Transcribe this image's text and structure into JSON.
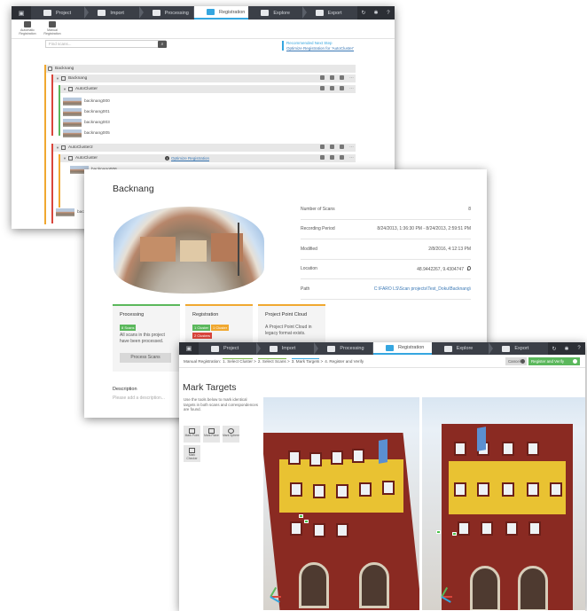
{
  "nav": {
    "tabs": [
      {
        "label": "Project"
      },
      {
        "label": "Import"
      },
      {
        "label": "Processing"
      },
      {
        "label": "Registration"
      },
      {
        "label": "Explore"
      },
      {
        "label": "Export"
      }
    ]
  },
  "win1": {
    "ribbon": [
      {
        "label": "Automatic Registration"
      },
      {
        "label": "Manual Registration"
      }
    ],
    "search_placeholder": "Find scans...",
    "recommended_title": "Recommended Next Step",
    "recommended_link": "Optimize Registration for 'AutoCluster'",
    "tree": {
      "root": "Backnang",
      "node1": "Backnang",
      "cluster1": "AutoCluster",
      "scans1": [
        "backnang000",
        "backnang001",
        "backnang003",
        "backnang005"
      ],
      "cluster2": "AutoCluster2",
      "cluster3": "AutoCluster",
      "optimize": "Optimize Registration",
      "scan6": "backnang006",
      "partial": "back"
    }
  },
  "win2": {
    "title": "Backnang",
    "properties": [
      {
        "key": "Number of Scans",
        "value": "8"
      },
      {
        "key": "Recording Period",
        "value": "8/24/2013, 1:36:30 PM - 8/24/2013, 2:59:51 PM"
      },
      {
        "key": "Modified",
        "value": "2/8/2016, 4:12:13 PM"
      },
      {
        "key": "Location",
        "value": "48.9442267, 9.4304747"
      },
      {
        "key": "Path",
        "value": "C:\\FARO LS\\Scan projects\\Test_Doku\\Backnang\\"
      }
    ],
    "cards": {
      "processing": {
        "title": "Processing",
        "badge": "8 Scans",
        "desc": "All scans in this project have been processed.",
        "button": "Process Scans"
      },
      "registration": {
        "title": "Registration",
        "badges": [
          "1 Cluster",
          "1 Cluster",
          "2 Clusters"
        ]
      },
      "pointcloud": {
        "title": "Project Point Cloud",
        "desc": "A Project Point Cloud in legacy format exists."
      }
    },
    "description_label": "Description",
    "description_placeholder": "Please add a description..."
  },
  "win3": {
    "wizard_prefix": "Manual Registration:",
    "steps": [
      "1. Select Cluster",
      "2. Select Scans",
      "3. Mark Targets",
      "4. Register and Verify"
    ],
    "cancel": "Cancel",
    "verify": "Register and Verify",
    "title": "Mark Targets",
    "help": "Use the tools below to mark identical targets in both scans and correspondences are found.",
    "tools": [
      "Mark Point",
      "Mark Plane",
      "Mark Sphere",
      "Mark Checker"
    ]
  },
  "colors": {
    "topbar": "#3b3f47",
    "accent": "#35a6e0",
    "green": "#5bb85c",
    "orange": "#f0a830",
    "red": "#d9453b"
  }
}
